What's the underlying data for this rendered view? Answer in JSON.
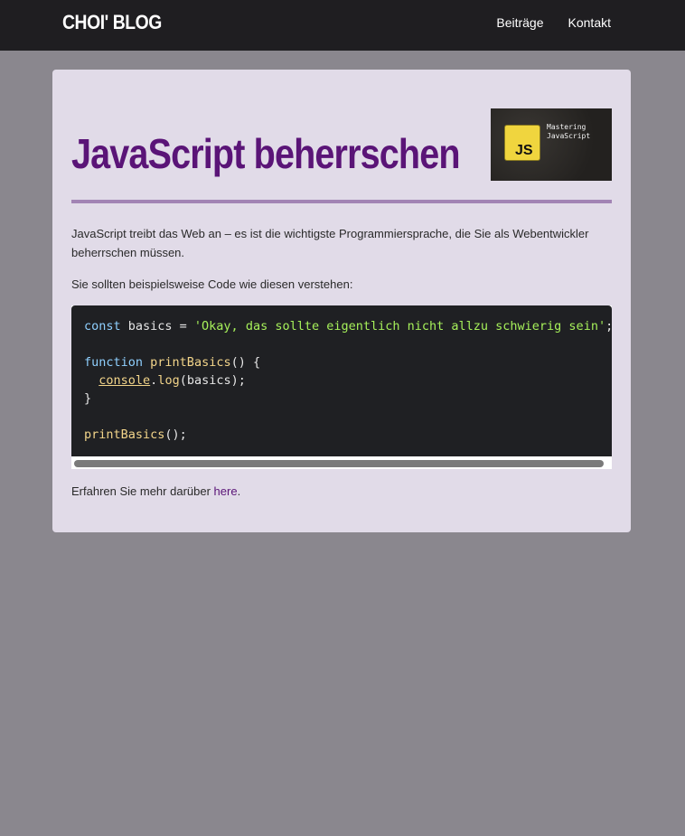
{
  "header": {
    "brand": "CHOI' BLOG",
    "nav": [
      {
        "label": "Beiträge"
      },
      {
        "label": "Kontakt"
      }
    ]
  },
  "post": {
    "title": "JavaScript beherrschen",
    "thumbnail": {
      "badge": "JS",
      "line1": "Mastering",
      "line2": "JavaScript"
    },
    "intro": "JavaScript treibt das Web an – es ist die wichtigste Programmiersprache, die Sie als Webentwickler beherrschen müssen.",
    "lead": "Sie sollten beispielsweise Code wie diesen verstehen:",
    "code": {
      "l1_kw": "const",
      "l1_name": " basics = ",
      "l1_str": "'Okay, das sollte eigentlich nicht allzu schwierig sein'",
      "l1_end": ";",
      "l3_kw": "function",
      "l3_fn": "printBasics",
      "l3_end": "() {",
      "l4_indent": "  ",
      "l4_obj": "console",
      "l4_dot": ".",
      "l4_method": "log",
      "l4_args": "(basics);",
      "l5": "}",
      "l7_fn": "printBasics",
      "l7_end": "();"
    },
    "outro_text": "Erfahren Sie mehr darüber ",
    "outro_link": "here",
    "outro_end": "."
  },
  "colors": {
    "page_bg": "#8a878e",
    "topbar_bg": "#1f1e21",
    "card_bg": "#e1dbe8",
    "title": "#5a1477",
    "rule": "#a284b4",
    "code_bg": "#1f2023"
  }
}
